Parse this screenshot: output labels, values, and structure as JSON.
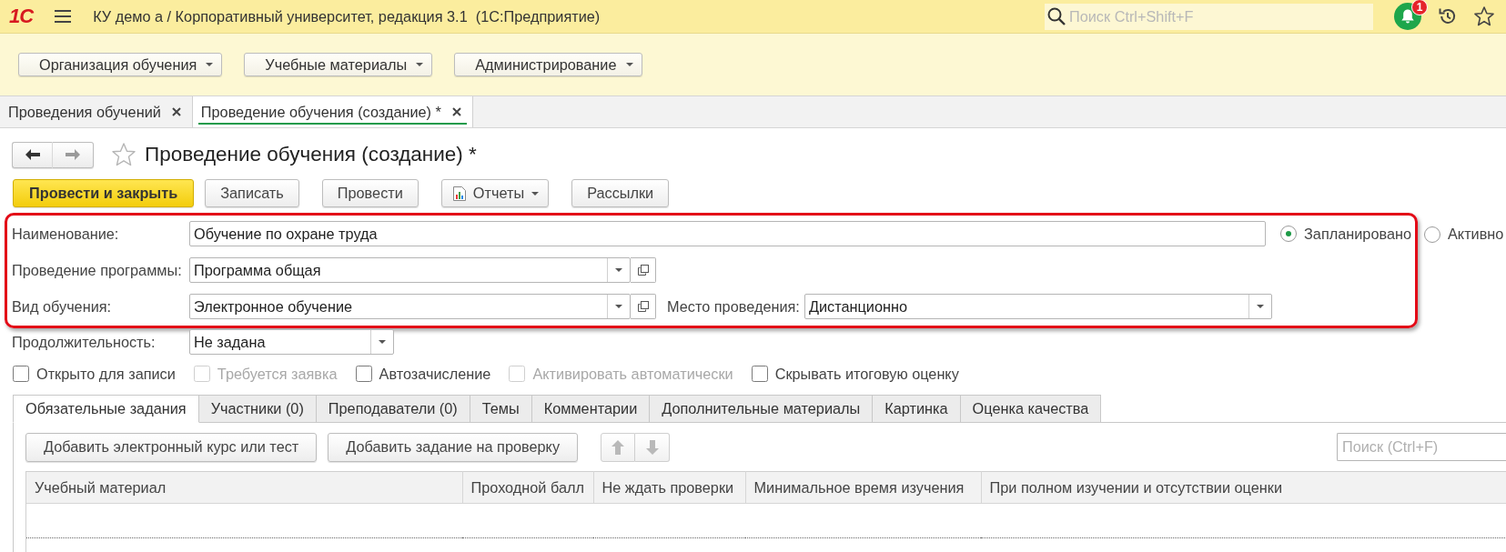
{
  "top_bar": {
    "logo": "1С",
    "title": "КУ демо а / Корпоративный университет, редакция 3.1  (1С:Предприятие)",
    "search": {
      "placeholder": "Поиск Ctrl+Shift+F"
    },
    "notifications": "1"
  },
  "section_menu": [
    {
      "label": "Организация обучения"
    },
    {
      "label": "Учебные материалы"
    },
    {
      "label": "Администрирование"
    }
  ],
  "window_tabs": [
    {
      "label": "Проведения обучений",
      "selected": false
    },
    {
      "label": "Проведение обучения (создание) *",
      "selected": true
    }
  ],
  "form": {
    "title": "Проведение обучения (создание) *"
  },
  "toolbar": [
    {
      "label": "Провести и закрыть",
      "kind": "primary"
    },
    {
      "label": "Записать",
      "kind": "plain"
    },
    {
      "label": "Провести",
      "kind": "plain"
    },
    {
      "label": "Отчеты",
      "kind": "report_menu"
    },
    {
      "label": "Рассылки",
      "kind": "plain"
    }
  ],
  "highlighted_rows": [
    {
      "fields": [
        {
          "label": "Наименование:",
          "value": "Обучение по охране труда",
          "kind": "text"
        }
      ]
    },
    {
      "fields": [
        {
          "label": "Проведение программы:",
          "value": "Программа общая",
          "kind": "select_open"
        }
      ]
    },
    {
      "fields": [
        {
          "label": "Вид обучения:",
          "value": "Электронное обучение",
          "kind": "select_open"
        },
        {
          "label": "Место проведения:",
          "value": "Дистанционно",
          "kind": "select"
        }
      ]
    }
  ],
  "status_options": [
    {
      "label": "Запланировано",
      "selected": true
    },
    {
      "label": "Активно",
      "selected": false
    }
  ],
  "duration": {
    "label": "Продолжительность:",
    "value": "Не задана",
    "kind": "select"
  },
  "options": [
    {
      "label": "Открыто для записи",
      "checked": false,
      "disabled": false
    },
    {
      "label": "Требуется заявка",
      "checked": false,
      "disabled": true
    },
    {
      "label": "Автозачисление",
      "checked": false,
      "disabled": false
    },
    {
      "label": "Активировать автоматически",
      "checked": false,
      "disabled": true
    },
    {
      "label": "Скрывать итоговую оценку",
      "checked": false,
      "disabled": false
    }
  ],
  "detail_tabs": [
    {
      "label": "Обязательные задания",
      "selected": true
    },
    {
      "label": "Участники (0)",
      "selected": false
    },
    {
      "label": "Преподаватели (0)",
      "selected": false
    },
    {
      "label": "Темы",
      "selected": false
    },
    {
      "label": "Комментарии",
      "selected": false
    },
    {
      "label": "Дополнительные материалы",
      "selected": false
    },
    {
      "label": "Картинка",
      "selected": false
    },
    {
      "label": "Оценка качества",
      "selected": false
    }
  ],
  "tasks_panel": {
    "buttons": [
      {
        "label": "Добавить электронный курс или тест"
      },
      {
        "label": "Добавить задание на проверку"
      }
    ],
    "search": {
      "placeholder": "Поиск (Ctrl+F)"
    },
    "table": {
      "columns": [
        "Учебный материал",
        "Проходной балл",
        "Не ждать проверки",
        "Минимальное время изучения",
        "При полном изучении и отсутствии оценки"
      ]
    }
  }
}
